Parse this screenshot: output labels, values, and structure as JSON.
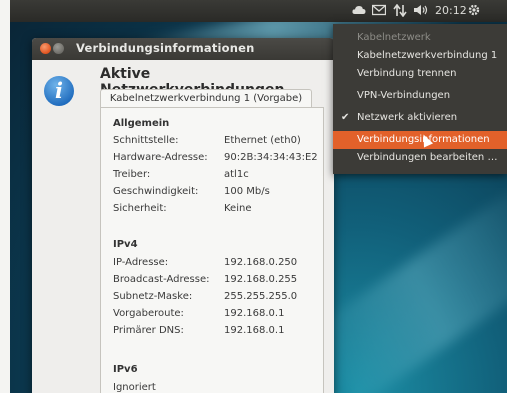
{
  "panel": {
    "clock": "20:12",
    "icons": [
      "cloud-icon",
      "mail-icon",
      "network-icon",
      "volume-icon",
      "gear-icon"
    ]
  },
  "dialog": {
    "title": "Verbindungsinformationen",
    "heading": "Aktive Netzwerkverbindungen",
    "tab_label": "Kabelnetzwerkverbindung 1 (Vorgabe)",
    "sections": {
      "general": {
        "title": "Allgemein",
        "rows": [
          {
            "key": "Schnittstelle:",
            "value": "Ethernet (eth0)"
          },
          {
            "key": "Hardware-Adresse:",
            "value": "90:2B:34:34:43:E2"
          },
          {
            "key": "Treiber:",
            "value": "atl1c"
          },
          {
            "key": "Geschwindigkeit:",
            "value": "100 Mb/s"
          },
          {
            "key": "Sicherheit:",
            "value": "Keine"
          }
        ]
      },
      "ipv4": {
        "title": "IPv4",
        "rows": [
          {
            "key": "IP-Adresse:",
            "value": "192.168.0.250"
          },
          {
            "key": "Broadcast-Adresse:",
            "value": "192.168.0.255"
          },
          {
            "key": "Subnetz-Maske:",
            "value": "255.255.255.0"
          },
          {
            "key": "Vorgaberoute:",
            "value": "192.168.0.1"
          },
          {
            "key": "Primärer DNS:",
            "value": "192.168.0.1"
          }
        ]
      },
      "ipv6": {
        "title": "IPv6",
        "status": "Ignoriert"
      }
    }
  },
  "menu": {
    "header": "Kabelnetzwerk",
    "connection": "Kabelnetzwerkverbindung 1",
    "disconnect": "Verbindung trennen",
    "vpn": "VPN-Verbindungen",
    "enable_network": "Netzwerk aktivieren",
    "connection_info": "Verbindungsinformationen",
    "edit_connections": "Verbindungen bearbeiten …"
  },
  "colors": {
    "accent": "#e2612a",
    "panel": "#3a3a36",
    "menu": "#3c3b37",
    "dialog_bg": "#efeeec"
  }
}
